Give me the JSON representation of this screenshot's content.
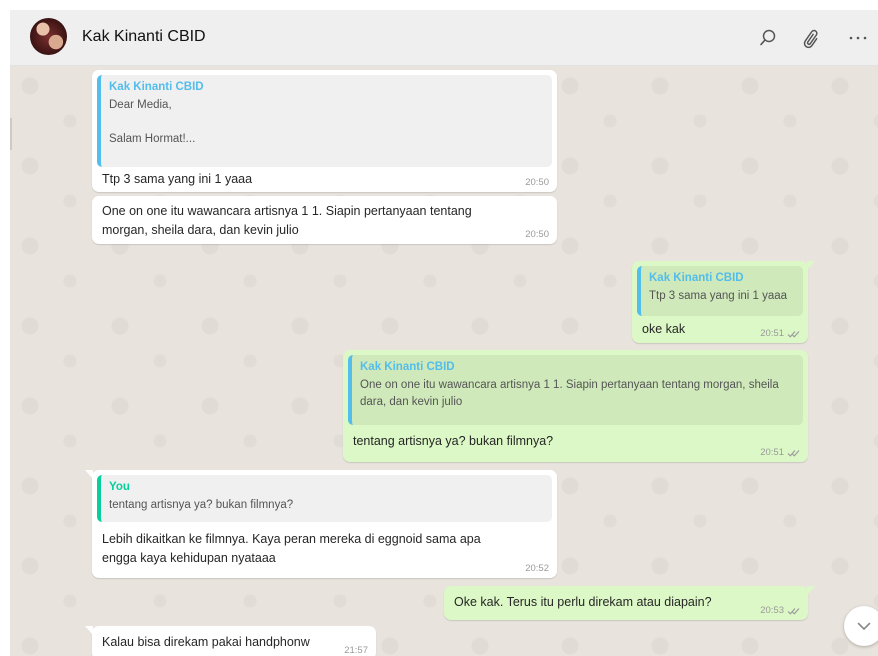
{
  "header": {
    "contact_name": "Kak Kinanti CBID",
    "icons": [
      "search-icon",
      "attach-icon",
      "more-icon"
    ]
  },
  "messages": [
    {
      "dir": "in",
      "quote": {
        "author": "Kak Kinanti CBID",
        "text": "Dear Media,\n\nSalam Hormat!..."
      },
      "text": "Ttp 3 sama yang ini 1 yaaa",
      "time": "20:50"
    },
    {
      "dir": "in",
      "text": "One on one itu wawancara artisnya 1 1. Siapin pertanyaan tentang morgan, sheila dara, dan kevin julio",
      "time": "20:50"
    },
    {
      "dir": "out",
      "quote": {
        "author": "Kak Kinanti CBID",
        "text": "Ttp 3 sama yang ini 1 yaaa"
      },
      "text": "oke kak",
      "time": "20:51",
      "status": "read"
    },
    {
      "dir": "out",
      "quote": {
        "author": "Kak Kinanti CBID",
        "text": "One on one itu wawancara artisnya 1 1. Siapin pertanyaan tentang morgan, sheila dara, dan kevin julio"
      },
      "text": "tentang artisnya ya? bukan filmnya?",
      "time": "20:51",
      "status": "read"
    },
    {
      "dir": "in",
      "quote": {
        "author": "You",
        "text": "tentang artisnya ya? bukan filmnya?"
      },
      "text": "Lebih dikaitkan ke filmnya. Kaya peran mereka di eggnoid sama apa engga kaya kehidupan nyataaa",
      "time": "20:52"
    },
    {
      "dir": "out",
      "text": "Oke kak. Terus itu perlu direkam atau diapain?",
      "time": "20:53",
      "status": "read"
    },
    {
      "dir": "in",
      "text": "Kalau bisa direkam pakai handphonw",
      "time": "21:57"
    }
  ],
  "colors": {
    "header_bg": "#efefef",
    "chat_bg": "#e8e3dc",
    "incoming_bubble": "#ffffff",
    "outgoing_bubble": "#dcf8c6",
    "quote_author": "#53bdeb",
    "you_author": "#06cf9c",
    "read_ticks": "#4fc3f7"
  }
}
